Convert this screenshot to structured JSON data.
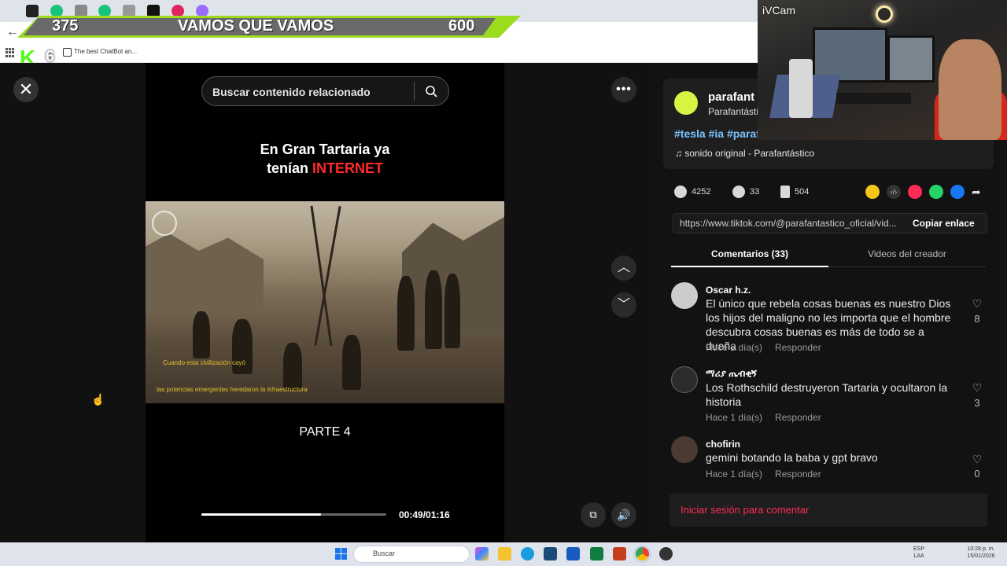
{
  "overlay": {
    "left_number": "375",
    "center_text": "VAMOS QUE VAMOS",
    "right_number": "600",
    "kick_count": "6"
  },
  "browser": {
    "bookmark_label": "The best ChatBot an..."
  },
  "video": {
    "search_placeholder": "Buscar contenido relacionado",
    "title_line1": "En Gran Tartaria ya",
    "title_line2_a": "tenían ",
    "title_line2_b": "INTERNET",
    "subtitle1": "Cuando esta civilización cayó",
    "subtitle2": "las potencias emergentes heredaron la infraestructura",
    "parte": "PARTE 4",
    "time": "00:49/01:16",
    "progress": 0.645
  },
  "post": {
    "username": "parafant",
    "nickname": "Parafantásti",
    "tags": "#tesla #ia #paraf",
    "sound": "♫  sonido original - Parafantástico",
    "likes": "4252",
    "comments": "33",
    "saves": "504",
    "url": "https://www.tiktok.com/@parafantastico_oficial/vid...",
    "copy_label": "Copiar enlace"
  },
  "tabs": {
    "comments": "Comentarios (33)",
    "creator_videos": "Videos del creador"
  },
  "comments": [
    {
      "name": "Oscar h.z.",
      "text": "El único que rebela cosas buenas es nuestro Dios los hijos del maligno no les importa que el hombre descubra cosas buenas es más de todo se a dueña",
      "time": "Hace 2 día(s)",
      "reply": "Responder",
      "likes": "8"
    },
    {
      "name": "ማሪያ ጤብቂኝ",
      "text": "Los Rothschild destruyeron Tartaria y ocultaron la historia",
      "time": "Hace 1 día(s)",
      "reply": "Responder",
      "likes": "3"
    },
    {
      "name": "chofirin",
      "text": "gemini botando la baba y gpt bravo",
      "time": "Hace 1 día(s)",
      "reply": "Responder",
      "likes": "0"
    }
  ],
  "login_label": "Iniciar sesión para comentar",
  "webcam_label": "iVCam",
  "taskbar": {
    "search": "Buscar",
    "lang": "ESP\nLAA",
    "time": "10:28 p. m.",
    "date": "15/01/2026"
  },
  "colors": {
    "banner_green": "#9cdc1f",
    "accent_red": "#fe2c55",
    "tag_blue": "#7bc3ff"
  }
}
